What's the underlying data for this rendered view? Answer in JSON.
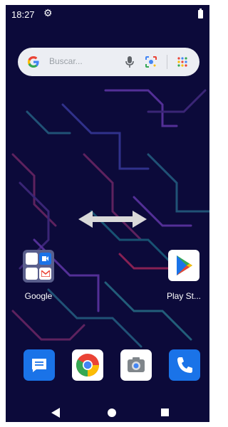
{
  "status_bar": {
    "time": "18:27",
    "settings_icon": "gear-icon",
    "battery_icon": "battery-icon"
  },
  "search_bar": {
    "placeholder": "Buscar...",
    "logo": "google-g-icon",
    "voice_icon": "mic-icon",
    "lens_icon": "lens-icon",
    "apps_icon": "grid-icon"
  },
  "overlay": {
    "icon": "double-arrow-horizontal-icon"
  },
  "home_apps": [
    {
      "label": "Google",
      "icon": "folder-icon"
    },
    {
      "label": "Play St...",
      "icon": "play-store-icon"
    }
  ],
  "dock": [
    {
      "name": "messages",
      "icon": "messages-icon",
      "color": "#1a73e8"
    },
    {
      "name": "chrome",
      "icon": "chrome-icon",
      "color": "#ffffff"
    },
    {
      "name": "camera",
      "icon": "camera-icon",
      "color": "#ffffff"
    },
    {
      "name": "phone",
      "icon": "phone-icon",
      "color": "#1a73e8"
    }
  ],
  "nav_bar": {
    "back": "back-icon",
    "home": "home-icon",
    "recents": "recents-icon"
  }
}
